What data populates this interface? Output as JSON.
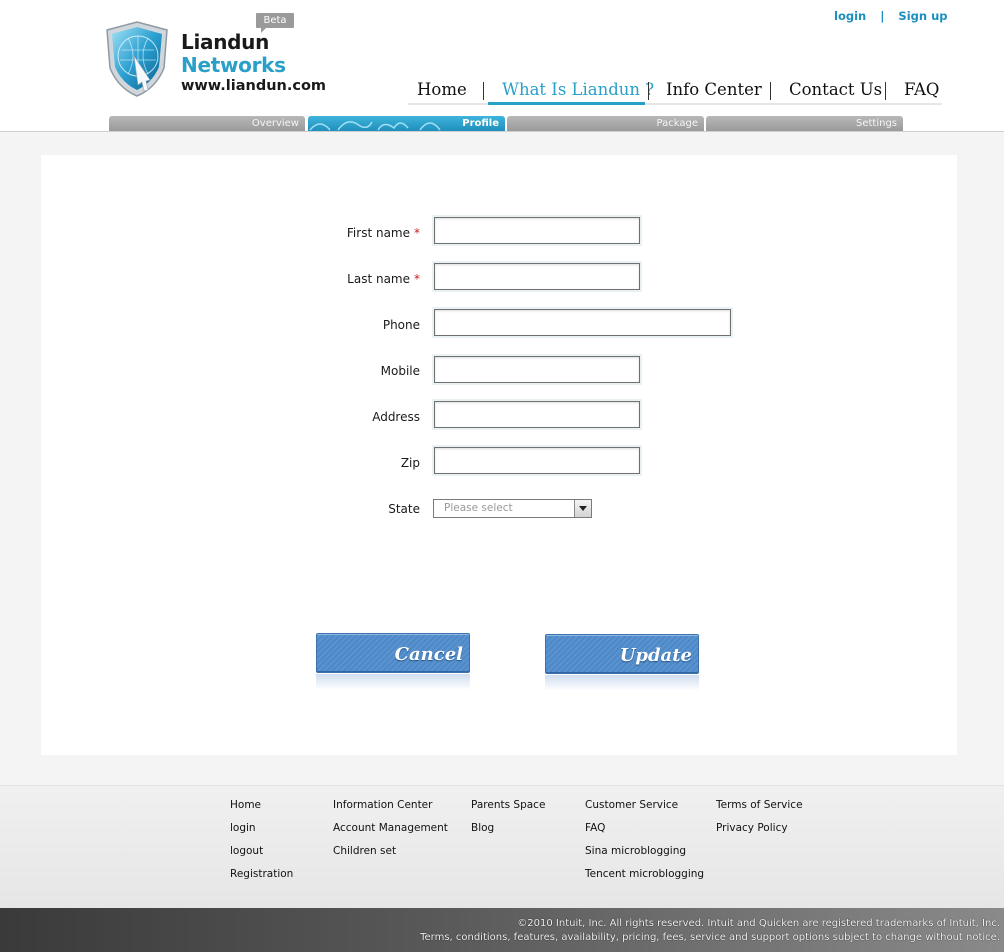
{
  "brand": {
    "line1": "Liandun",
    "line2": "Networks",
    "domain": "www.liandun.com",
    "beta": "Beta",
    "accent_color": "#2aa0c8"
  },
  "auth": {
    "login": "login",
    "separator": "|",
    "signup": "Sign up"
  },
  "nav": {
    "items": [
      {
        "label": "Home"
      },
      {
        "label": "What Is Liandun ?",
        "active": true
      },
      {
        "label": "Info Center"
      },
      {
        "label": "Contact Us"
      },
      {
        "label": "FAQ"
      }
    ],
    "separator": "|"
  },
  "subtabs": [
    {
      "label": "Overview"
    },
    {
      "label": "Profile",
      "active": true
    },
    {
      "label": "Package"
    },
    {
      "label": "Settings"
    }
  ],
  "form": {
    "first_name": {
      "label": "First name",
      "required_mark": "*",
      "value": ""
    },
    "last_name": {
      "label": "Last name",
      "required_mark": "*",
      "value": ""
    },
    "phone": {
      "label": "Phone",
      "value": ""
    },
    "mobile": {
      "label": "Mobile",
      "value": ""
    },
    "address": {
      "label": "Address",
      "value": ""
    },
    "zip": {
      "label": "Zip",
      "value": ""
    },
    "state": {
      "label": "State",
      "selected": "Please select"
    }
  },
  "buttons": {
    "cancel": "Cancel",
    "update": "Update"
  },
  "footer": {
    "columns": [
      [
        "Home",
        "login",
        "logout",
        "Registration"
      ],
      [
        "Information Center",
        "Account Management",
        "Children set"
      ],
      [
        "Parents Space",
        "Blog"
      ],
      [
        "Customer Service",
        "FAQ",
        "Sina microblogging",
        "Tencent microblogging"
      ],
      [
        "Terms of Service",
        "Privacy Policy"
      ]
    ],
    "copyright_line1": "©2010 Intuit, Inc. All rights reserved. Intuit and Quicken are registered trademarks of Intuit, Inc.",
    "copyright_line2": "Terms, conditions, features, availability, pricing, fees, service and support options subject to change without notice."
  }
}
